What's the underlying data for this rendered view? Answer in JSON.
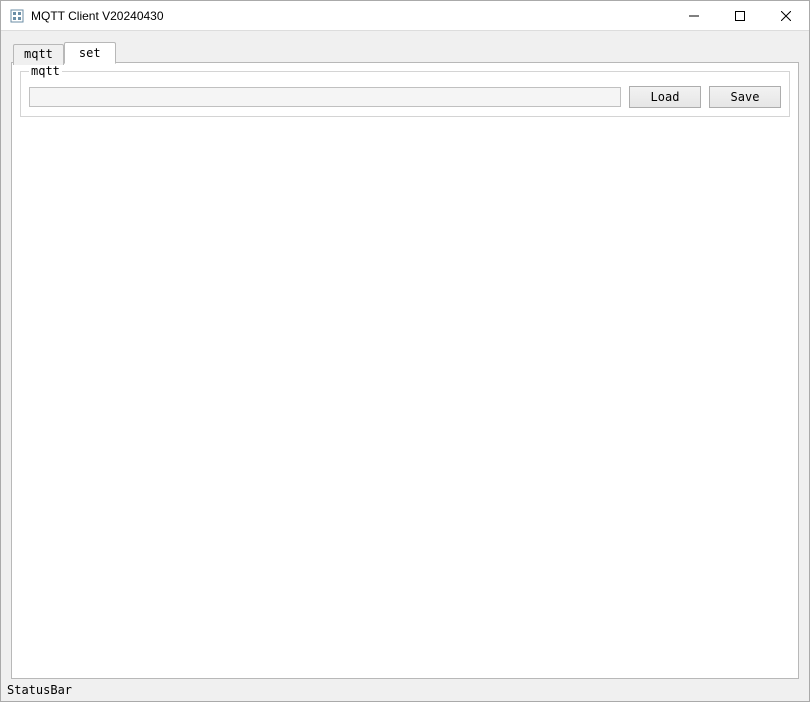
{
  "window": {
    "title": "MQTT Client V20240430"
  },
  "tabs": {
    "items": [
      {
        "label": "mqtt",
        "active": false
      },
      {
        "label": "set",
        "active": true
      }
    ]
  },
  "group": {
    "title": "mqtt",
    "path_value": "",
    "load_label": "Load",
    "save_label": "Save"
  },
  "status": {
    "text": "StatusBar"
  }
}
